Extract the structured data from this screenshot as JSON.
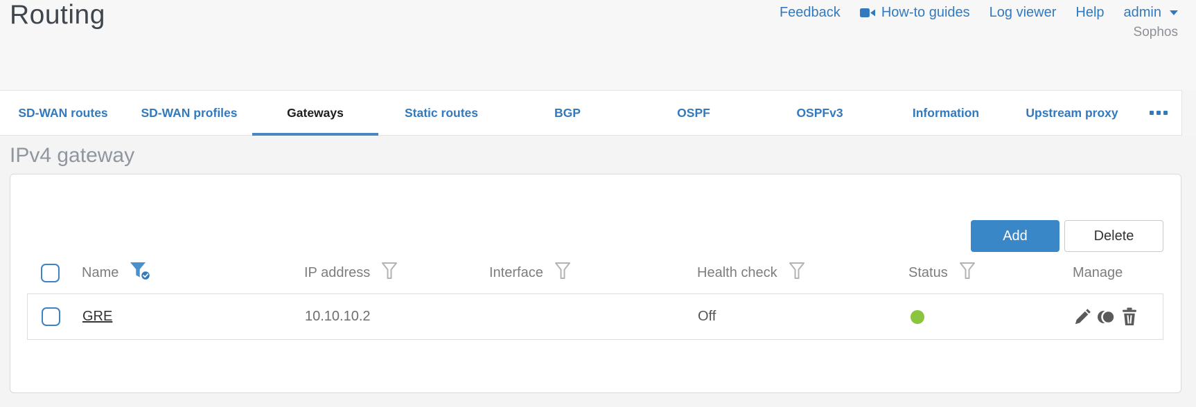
{
  "header": {
    "title": "Routing",
    "links": {
      "feedback": "Feedback",
      "howto": "How-to guides",
      "log_viewer": "Log viewer",
      "help": "Help",
      "user": "admin"
    },
    "brand": "Sophos"
  },
  "tabs": {
    "items": [
      {
        "label": "SD-WAN routes",
        "active": false
      },
      {
        "label": "SD-WAN profiles",
        "active": false
      },
      {
        "label": "Gateways",
        "active": true
      },
      {
        "label": "Static routes",
        "active": false
      },
      {
        "label": "BGP",
        "active": false
      },
      {
        "label": "OSPF",
        "active": false
      },
      {
        "label": "OSPFv3",
        "active": false
      },
      {
        "label": "Information",
        "active": false
      },
      {
        "label": "Upstream proxy",
        "active": false
      }
    ],
    "more_icon": "ellipsis-icon"
  },
  "section_title": "IPv4 gateway",
  "toolbar": {
    "add_label": "Add",
    "delete_label": "Delete"
  },
  "table": {
    "columns": [
      {
        "label": "Name",
        "filter": "active"
      },
      {
        "label": "IP address",
        "filter": "inactive"
      },
      {
        "label": "Interface",
        "filter": "inactive"
      },
      {
        "label": "Health check",
        "filter": "inactive"
      },
      {
        "label": "Status",
        "filter": "inactive"
      },
      {
        "label": "Manage",
        "filter": "none"
      }
    ],
    "rows": [
      {
        "name": "GRE",
        "ip_address": "10.10.10.2",
        "interface": "",
        "health_check": "Off",
        "status": "up"
      }
    ]
  },
  "colors": {
    "accent_blue": "#3279be",
    "button_blue": "#3a87c8",
    "status_green": "#8bc53f"
  }
}
